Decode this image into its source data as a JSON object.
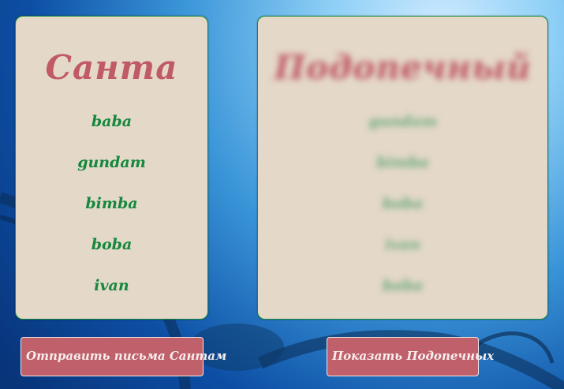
{
  "santa_panel": {
    "title": "Санта",
    "names": [
      "baba",
      "gundam",
      "bimba",
      "boba",
      "ivan"
    ]
  },
  "wards_panel": {
    "title": "Подопечный",
    "names": [
      "gundam",
      "bimba",
      "boba",
      "ivan",
      "baba"
    ]
  },
  "buttons": {
    "send_letters": "Отправить письма Сантам",
    "show_wards": "Показать Подопечных"
  },
  "colors": {
    "card_bg": "#e4d8c9",
    "card_border": "#1a8a3a",
    "title": "#c05a64",
    "names": "#14883c",
    "button_bg": "#c0606a"
  }
}
